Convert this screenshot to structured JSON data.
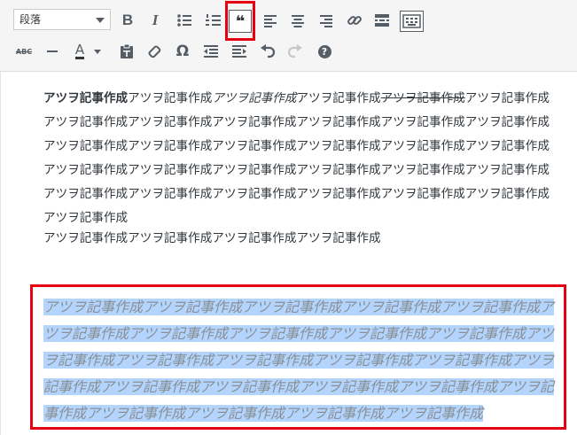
{
  "toolbar": {
    "format_select": {
      "value": "段落"
    },
    "row1_icons": [
      "bold-icon",
      "italic-icon",
      "bullet-list-icon",
      "numbered-list-icon",
      "blockquote-icon",
      "align-left-icon",
      "align-center-icon",
      "align-right-icon",
      "link-icon",
      "read-more-icon",
      "toolbar-toggle-icon"
    ],
    "row2_icons": [
      "strikethrough-icon",
      "horizontal-line-icon",
      "text-color-icon",
      "paste-as-text-icon",
      "clear-formatting-icon",
      "special-character-icon",
      "outdent-icon",
      "indent-icon",
      "undo-icon",
      "redo-icon",
      "help-icon"
    ],
    "bold_glyph": "B",
    "italic_glyph": "I",
    "quote_glyph": "❝",
    "strike_glyph": "ABC",
    "text_color_glyph": "A",
    "omega_glyph": "Ω",
    "help_glyph": "?",
    "highlight_color": "#e60012"
  },
  "editor": {
    "paragraph1": {
      "bold": "アツヲ記事作成",
      "plain1": "アツヲ記事作成",
      "italic": "アツヲ記事作成",
      "plain2": "アツヲ記事作成",
      "strike": "アツヲ記事作成",
      "rest": "アツヲ記事作成アツヲ記事作成アツヲ記事作成アツヲ記事作成アツヲ記事作成アツヲ記事作成アツヲ記事作成アツヲ記事作成アツヲ記事作成アツヲ記事作成アツヲ記事作成アツヲ記事作成アツヲ記事作成アツヲ記事作成アツヲ記事作成アツヲ記事作成アツヲ記事作成アツヲ記事作成アツヲ記事作成アツヲ記事作成アツヲ記事作成アツヲ記事作成アツヲ記事作成アツヲ記事作成アツヲ記事作成アツヲ記事作成"
    },
    "paragraph2": "アツヲ記事作成アツヲ記事作成アツヲ記事作成アツヲ記事作成",
    "blockquote": "アツヲ記事作成アツヲ記事作成アツヲ記事作成アツヲ記事作成アツヲ記事作成アツヲ記事作成アツヲ記事作成アツヲ記事作成アツヲ記事作成アツヲ記事作成アツヲ記事作成アツヲ記事作成アツヲ記事作成アツヲ記事作成アツヲ記事作成アツヲ記事作成アツヲ記事作成アツヲ記事作成アツヲ記事作成アツヲ記事作成アツヲ記事作成アツヲ記事作成アツヲ記事作成アツヲ記事作成アツヲ記事作成",
    "selection_color": "#b3d4fc"
  }
}
